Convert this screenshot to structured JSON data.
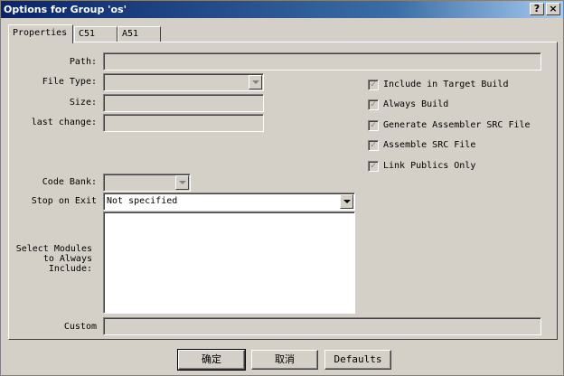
{
  "window": {
    "title": "Options for Group 'os'",
    "help_label": "?",
    "close_label": "×"
  },
  "tabs": [
    {
      "label": "Properties"
    },
    {
      "label": "C51"
    },
    {
      "label": "A51"
    }
  ],
  "fields": {
    "path_label": "Path:",
    "file_type_label": "File Type:",
    "size_label": "Size:",
    "last_change_label": "last change:",
    "code_bank_label": "Code Bank:",
    "stop_on_exit_label": "Stop on Exit",
    "stop_on_exit_value": "Not specified",
    "select_modules_label": "Select Modules to Always Include:",
    "custom_label": "Custom"
  },
  "options": [
    {
      "label": "Include in Target Build",
      "checked": true
    },
    {
      "label": "Always Build",
      "checked": true
    },
    {
      "label": "Generate Assembler SRC File",
      "checked": true
    },
    {
      "label": "Assemble SRC File",
      "checked": true
    },
    {
      "label": "Link Publics Only",
      "checked": true
    }
  ],
  "check_mark": "✓",
  "buttons": {
    "ok": "确定",
    "cancel": "取消",
    "defaults": "Defaults"
  }
}
